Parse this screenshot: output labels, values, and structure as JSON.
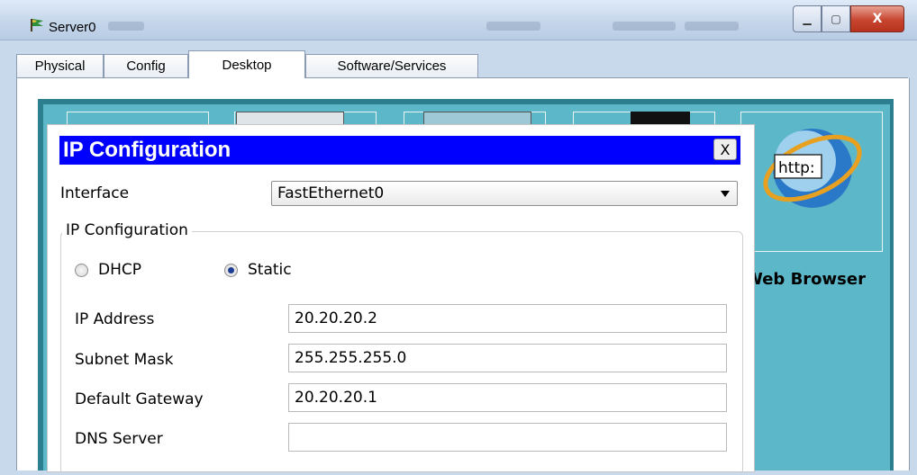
{
  "window": {
    "title": "Server0",
    "controls": {
      "minimize": "▁",
      "maximize": "▢",
      "close": "X"
    }
  },
  "tabs": [
    {
      "label": "Physical",
      "active": false
    },
    {
      "label": "Config",
      "active": false
    },
    {
      "label": "Desktop",
      "active": true
    },
    {
      "label": "Software/Services",
      "active": false
    }
  ],
  "desktop": {
    "web_browser_label": "Web Browser",
    "web_browser_icon_text": "http:"
  },
  "dialog": {
    "title": "IP Configuration",
    "close_label": "X",
    "interface_label": "Interface",
    "interface_value": "FastEthernet0",
    "group_label": "IP Configuration",
    "mode_options": [
      {
        "label": "DHCP",
        "selected": false
      },
      {
        "label": "Static",
        "selected": true
      }
    ],
    "fields": [
      {
        "label": "IP Address",
        "value": "20.20.20.2"
      },
      {
        "label": "Subnet Mask",
        "value": "255.255.255.0"
      },
      {
        "label": "Default Gateway",
        "value": "20.20.20.1"
      },
      {
        "label": "DNS Server",
        "value": ""
      }
    ]
  },
  "colors": {
    "dialog_title_bg": "#0000ff",
    "desktop_bg": "#5cb7c8",
    "radio_selected": "#1c3d91"
  }
}
